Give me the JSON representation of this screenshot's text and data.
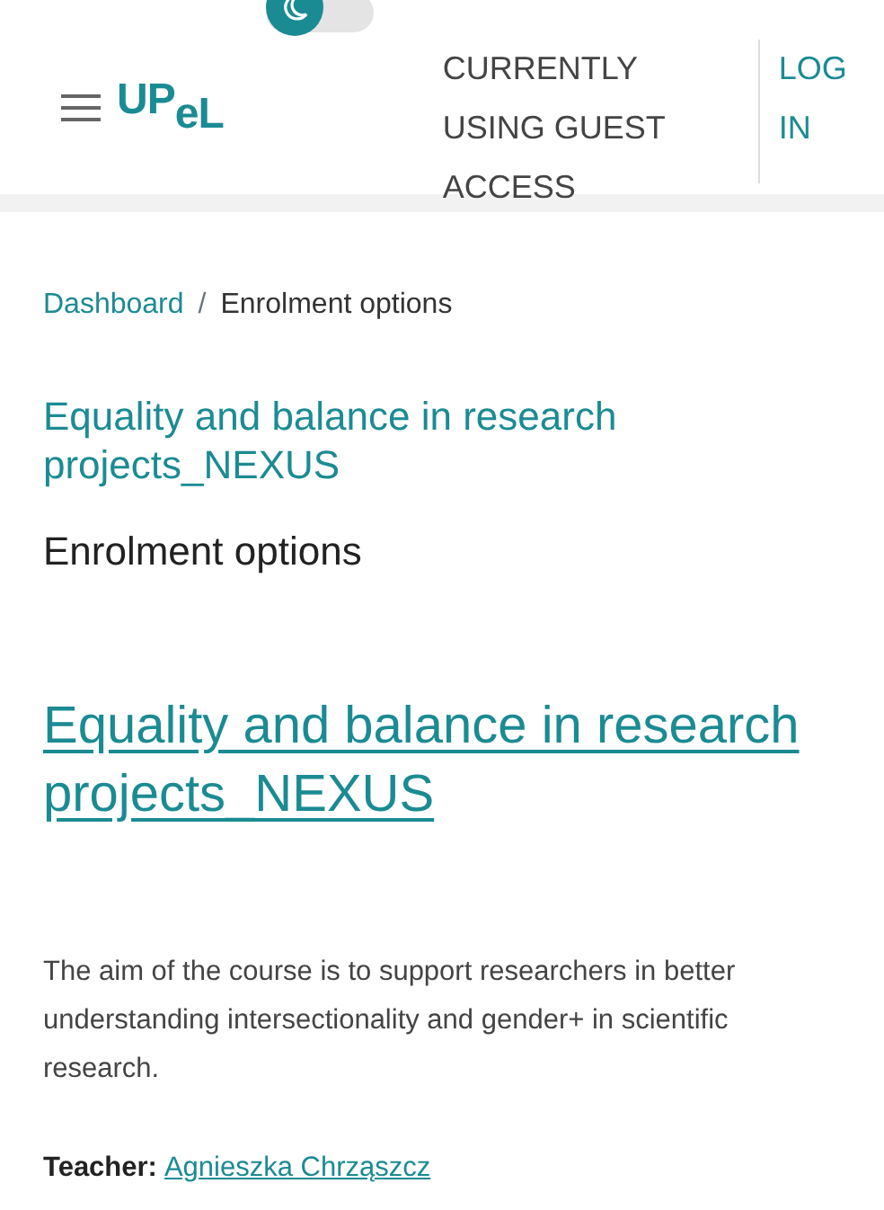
{
  "header": {
    "logo": "UP$_{eL}$",
    "dark_mode_toggle": {
      "on": false
    },
    "guest_notice": "CURRENTLY USING GUEST ACCESS",
    "login_link": "LOG IN"
  },
  "breadcrumb": [
    "Dashboard",
    "Enrolment options"
  ],
  "breadcrumb_separator": "/",
  "course_title": "Equality and balance in research projects_NEXUS",
  "page_heading": "Enrolment options",
  "course_box": {
    "title": "Equality and balance in research projects_NEXUS",
    "summary": "The aim of the course is to support researchers in better understanding intersectionality and gender+ in scientific research.",
    "teacher_label": "Teacher:",
    "teacher_name": "Agnieszka Chrząszcz"
  }
}
